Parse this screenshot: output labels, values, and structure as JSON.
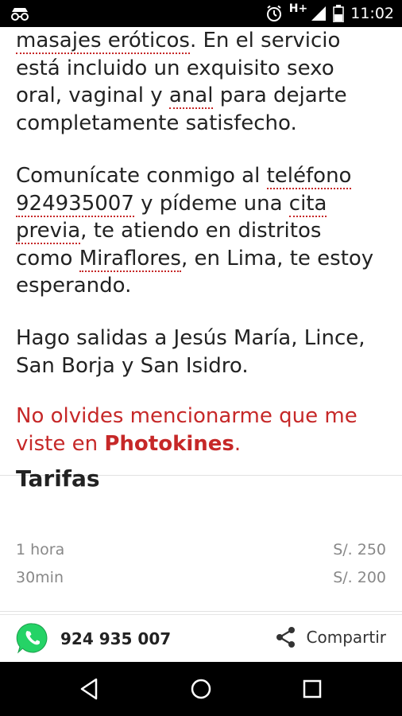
{
  "status_bar": {
    "network": "H+",
    "time": "11:02"
  },
  "content": {
    "p1": {
      "t1": "masajes eróticos",
      "t2": ". En el servicio está incluido un exquisito sexo oral, vaginal y ",
      "t3": "anal",
      "t4": " para dejarte completamente satisfecho."
    },
    "p2": {
      "t1": "Comunícate conmigo al ",
      "t2": "teléfono",
      "t3": " ",
      "t4": "924935007",
      "t5": " y pídeme una ",
      "t6": "cita previa",
      "t7": ", te atiendo en distritos como ",
      "t8": "Miraflores",
      "t9": ", en Lima, te estoy esperando."
    },
    "p3": "Hago salidas a Jesús María, Lince, San Borja y San Isidro.",
    "p4": {
      "t1": "No olvides mencionarme que me viste en ",
      "brand": "Photokines",
      "t2": "."
    }
  },
  "tarifas": {
    "title": "Tarifas",
    "rows": [
      {
        "label": "1 hora",
        "price": "S/. 250"
      },
      {
        "label": "30min",
        "price": "S/. 200"
      }
    ]
  },
  "action_bar": {
    "phone": "924 935 007",
    "share_label": "Compartir",
    "whatsapp_color": "#25D366"
  },
  "colors": {
    "accent_red": "#c62828"
  }
}
